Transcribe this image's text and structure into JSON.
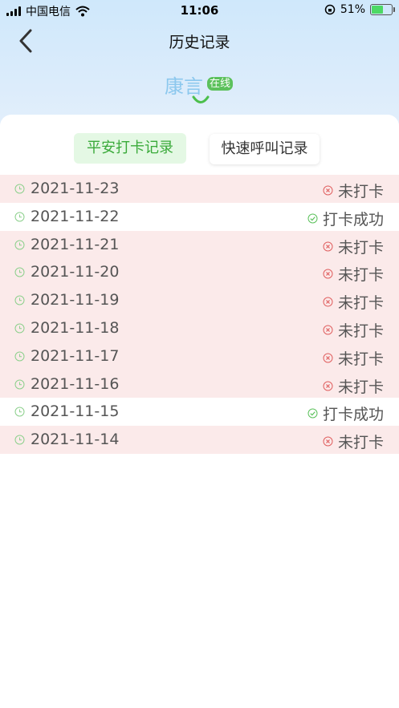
{
  "status_bar": {
    "carrier": "中国电信",
    "time": "11:06",
    "battery": "51%",
    "battery_level": 0.51
  },
  "nav": {
    "title": "历史记录"
  },
  "person": {
    "name": "康言",
    "status": "在线"
  },
  "tabs": [
    {
      "label": "平安打卡记录",
      "active": true
    },
    {
      "label": "快速呼叫记录",
      "active": false
    }
  ],
  "records": [
    {
      "date": "2021-11-23",
      "status": "未打卡"
    },
    {
      "date": "2021-11-22",
      "status": "打卡成功"
    },
    {
      "date": "2021-11-21",
      "status": "未打卡"
    },
    {
      "date": "2021-11-20",
      "status": "未打卡"
    },
    {
      "date": "2021-11-19",
      "status": "未打卡"
    },
    {
      "date": "2021-11-18",
      "status": "未打卡"
    },
    {
      "date": "2021-11-17",
      "status": "未打卡"
    },
    {
      "date": "2021-11-16",
      "status": "未打卡"
    },
    {
      "date": "2021-11-15",
      "status": "打卡成功"
    },
    {
      "date": "2021-11-14",
      "status": "未打卡"
    }
  ],
  "colors": {
    "accent_green": "#5cc15c",
    "missed_row_bg": "#fbeaea",
    "missed_icon": "#e06060",
    "ok_icon": "#5cc15c"
  }
}
